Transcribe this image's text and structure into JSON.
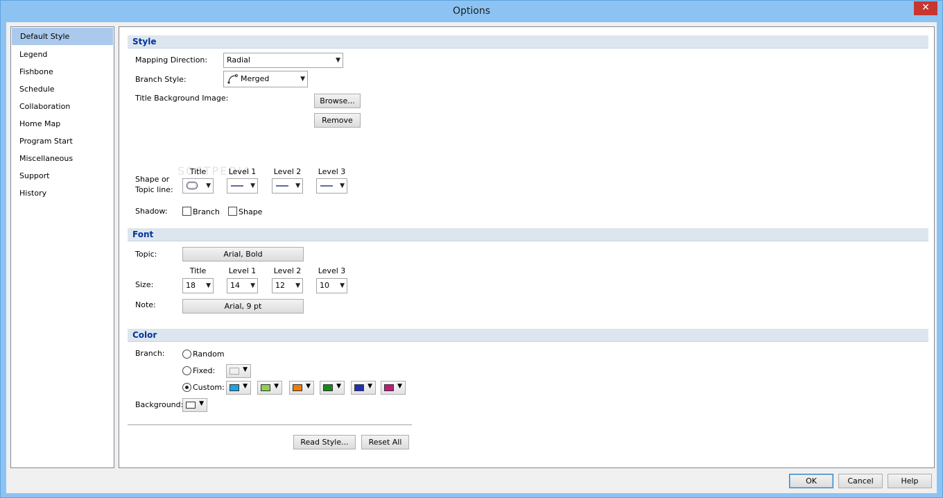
{
  "window": {
    "title": "Options",
    "close_glyph": "✕"
  },
  "sidebar": {
    "items": [
      {
        "label": "Default Style"
      },
      {
        "label": "Legend"
      },
      {
        "label": "Fishbone"
      },
      {
        "label": "Schedule"
      },
      {
        "label": "Collaboration"
      },
      {
        "label": "Home Map"
      },
      {
        "label": "Program Start"
      },
      {
        "label": "Miscellaneous"
      },
      {
        "label": "Support"
      },
      {
        "label": "History"
      }
    ]
  },
  "style": {
    "heading": "Style",
    "mapping_direction_label": "Mapping Direction:",
    "mapping_direction_value": "Radial",
    "branch_style_label": "Branch Style:",
    "branch_style_value": "Merged",
    "title_bg_label": "Title Background Image:",
    "browse_label": "Browse...",
    "remove_label": "Remove",
    "levels": [
      "Title",
      "Level 1",
      "Level 2",
      "Level 3"
    ],
    "shape_label_line1": "Shape or",
    "shape_label_line2": "Topic line:",
    "shadow_label": "Shadow:",
    "shadow_branch_label": "Branch",
    "shadow_shape_label": "Shape",
    "shadow_branch_checked": false,
    "shadow_shape_checked": false
  },
  "font": {
    "heading": "Font",
    "topic_label": "Topic:",
    "topic_value": "Arial, Bold",
    "levels": [
      "Title",
      "Level 1",
      "Level 2",
      "Level 3"
    ],
    "size_label": "Size:",
    "sizes": [
      "18",
      "14",
      "12",
      "10"
    ],
    "note_label": "Note:",
    "note_value": "Arial, 9 pt"
  },
  "color": {
    "heading": "Color",
    "branch_label": "Branch:",
    "random_label": "Random",
    "fixed_label": "Fixed:",
    "custom_label": "Custom:",
    "selected_mode": "Custom",
    "fixed_color": "#f0f0f0",
    "custom_colors": [
      "#1aa3e6",
      "#8fd14f",
      "#f07d00",
      "#138a1e",
      "#1f2fb8",
      "#c01a7c"
    ],
    "background_label": "Background:",
    "background_color": "#ffffff"
  },
  "actions": {
    "read_style_label": "Read Style...",
    "reset_all_label": "Reset All"
  },
  "footer": {
    "ok_label": "OK",
    "cancel_label": "Cancel",
    "help_label": "Help"
  },
  "watermark": "SOFTPEDIA"
}
